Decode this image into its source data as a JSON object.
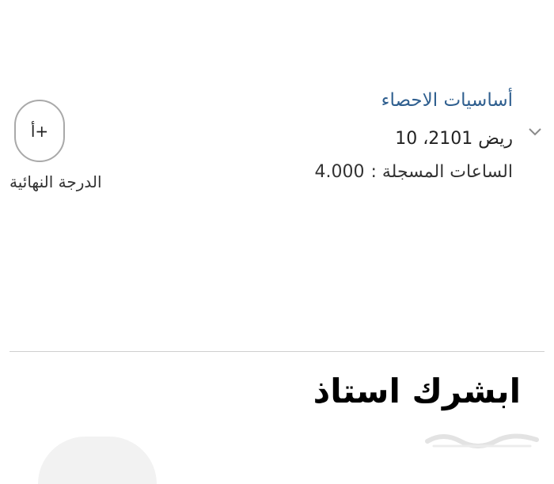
{
  "course": {
    "title": "أساسيات الاحصاء",
    "code": "ريض 2101، 10",
    "hours_label": "الساعات المسجلة :",
    "hours_value": "4.000",
    "grade": "أ+",
    "grade_label": "الدرجة النهائية",
    "expand_icon": "chevron-down-icon"
  },
  "caption": "ابشرك استاذ",
  "colors": {
    "title": "#2f5f8f",
    "text": "#222222",
    "circle_border": "#a9a9a9",
    "divider": "#cfcfcf"
  }
}
